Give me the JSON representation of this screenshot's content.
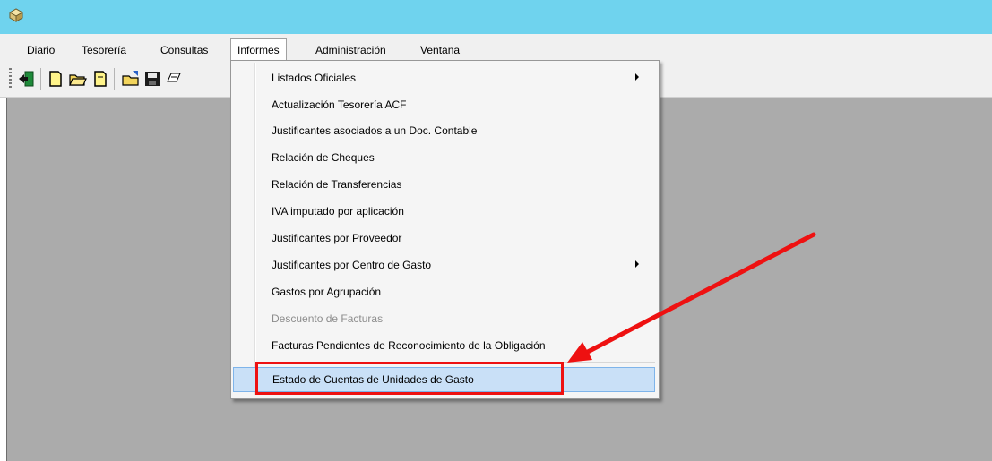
{
  "colors": {
    "titlebar": "#6fd3ee",
    "workspace": "#ababab",
    "highlight": "#c9e0f7",
    "annotation": "#ee1111",
    "disabled_text": "#8d8d8d"
  },
  "window": {
    "icon": "app-icon"
  },
  "menubar": {
    "items": [
      {
        "label": "Diario"
      },
      {
        "label": "Tesorería"
      },
      {
        "label": "Consultas"
      },
      {
        "label": "Informes",
        "active": true
      },
      {
        "label": "Administración"
      },
      {
        "label": "Ventana"
      }
    ]
  },
  "toolbar": {
    "buttons": [
      "exit-icon",
      "new-document-icon",
      "open-folder-icon",
      "new-page-icon",
      "open-file-icon",
      "save-icon",
      "print-icon"
    ]
  },
  "informes_menu": {
    "items": [
      {
        "label": "Listados Oficiales",
        "submenu": true
      },
      {
        "label": "Actualización Tesorería ACF"
      },
      {
        "label": "Justificantes asociados a un Doc. Contable"
      },
      {
        "label": "Relación de Cheques"
      },
      {
        "label": "Relación de Transferencias"
      },
      {
        "label": "IVA imputado por aplicación"
      },
      {
        "label": "Justificantes por Proveedor"
      },
      {
        "label": "Justificantes por Centro de Gasto",
        "submenu": true
      },
      {
        "label": "Gastos por Agrupación"
      },
      {
        "label": "Descuento de Facturas",
        "disabled": true
      },
      {
        "label": "Facturas Pendientes de Reconocimiento de la Obligación"
      },
      {
        "label": "Estado de Cuentas de Unidades de Gasto",
        "highlighted": true
      }
    ]
  }
}
